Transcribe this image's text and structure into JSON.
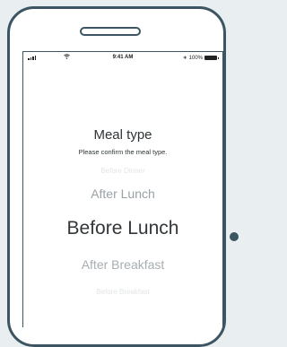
{
  "status_bar": {
    "time": "9:41 AM",
    "battery": "100%",
    "signal_icon": "signal-icon",
    "wifi_icon": "wifi-icon",
    "bluetooth_icon": "bluetooth-icon",
    "battery_icon": "battery-icon"
  },
  "screen": {
    "title": "Meal type",
    "subtitle": "Please confirm the meal type."
  },
  "picker": {
    "options": [
      "Before Dinner",
      "After Lunch",
      "Before Lunch",
      "After Breakfast",
      "Before Breakfast"
    ],
    "selected": "Before Lunch"
  },
  "colors": {
    "frame": "#3d5563",
    "text": "#2f3436",
    "background": "#e9eef0"
  }
}
